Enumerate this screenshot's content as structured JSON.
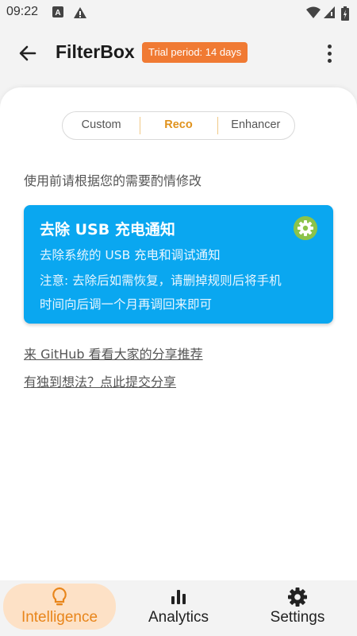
{
  "status": {
    "time": "09:22"
  },
  "appbar": {
    "title": "FilterBox",
    "trial_badge": "Trial period: 14 days"
  },
  "tabs": [
    {
      "label": "Custom",
      "selected": false
    },
    {
      "label": "Reco",
      "selected": true
    },
    {
      "label": "Enhancer",
      "selected": false
    }
  ],
  "hint": "使用前请根据您的需要酌情修改",
  "rule_card": {
    "title": "去除 USB 充电通知",
    "subtitle": "去除系统的 USB 充电和调试通知",
    "note_line1": "注意: 去除后如需恢复，请删掉规则后将手机",
    "note_line2": "时间向后调一个月再调回来即可",
    "color": "#0aa7f0"
  },
  "links": {
    "github": "来 GitHub 看看大家的分享推荐",
    "share": "有独到想法？点此提交分享"
  },
  "bottom_nav": [
    {
      "label": "Intelligence",
      "icon": "lightbulb-icon",
      "active": true
    },
    {
      "label": "Analytics",
      "icon": "bar-chart-icon",
      "active": false
    },
    {
      "label": "Settings",
      "icon": "gear-icon",
      "active": false
    }
  ],
  "accent": "#e8851a"
}
